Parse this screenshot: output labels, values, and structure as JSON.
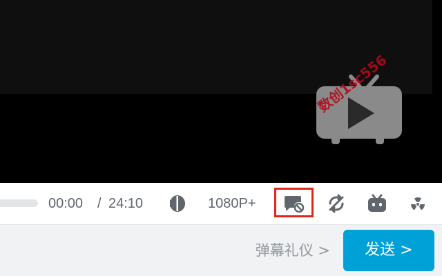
{
  "video": {
    "watermark_text": "数创1sc556",
    "logo_icon": "tv-play-icon"
  },
  "controls": {
    "time_current": "00:00",
    "time_separator": "/",
    "time_total": "24:10",
    "volume_icon": "volume-icon",
    "quality": "1080P+",
    "danmaku_toggle_icon": "danmaku-off-icon",
    "loop_icon": "loop-off-icon",
    "bot_icon": "bilibili-tv-icon",
    "radiation_icon": "radiation-icon",
    "progress_fraction": 0.0
  },
  "bottom": {
    "etiquette_label": "弹幕礼仪 >",
    "send_label": "发送 >"
  },
  "colors": {
    "accent": "#00a1d6",
    "highlight_border": "#e0261b",
    "icon_gray": "#61666d"
  }
}
